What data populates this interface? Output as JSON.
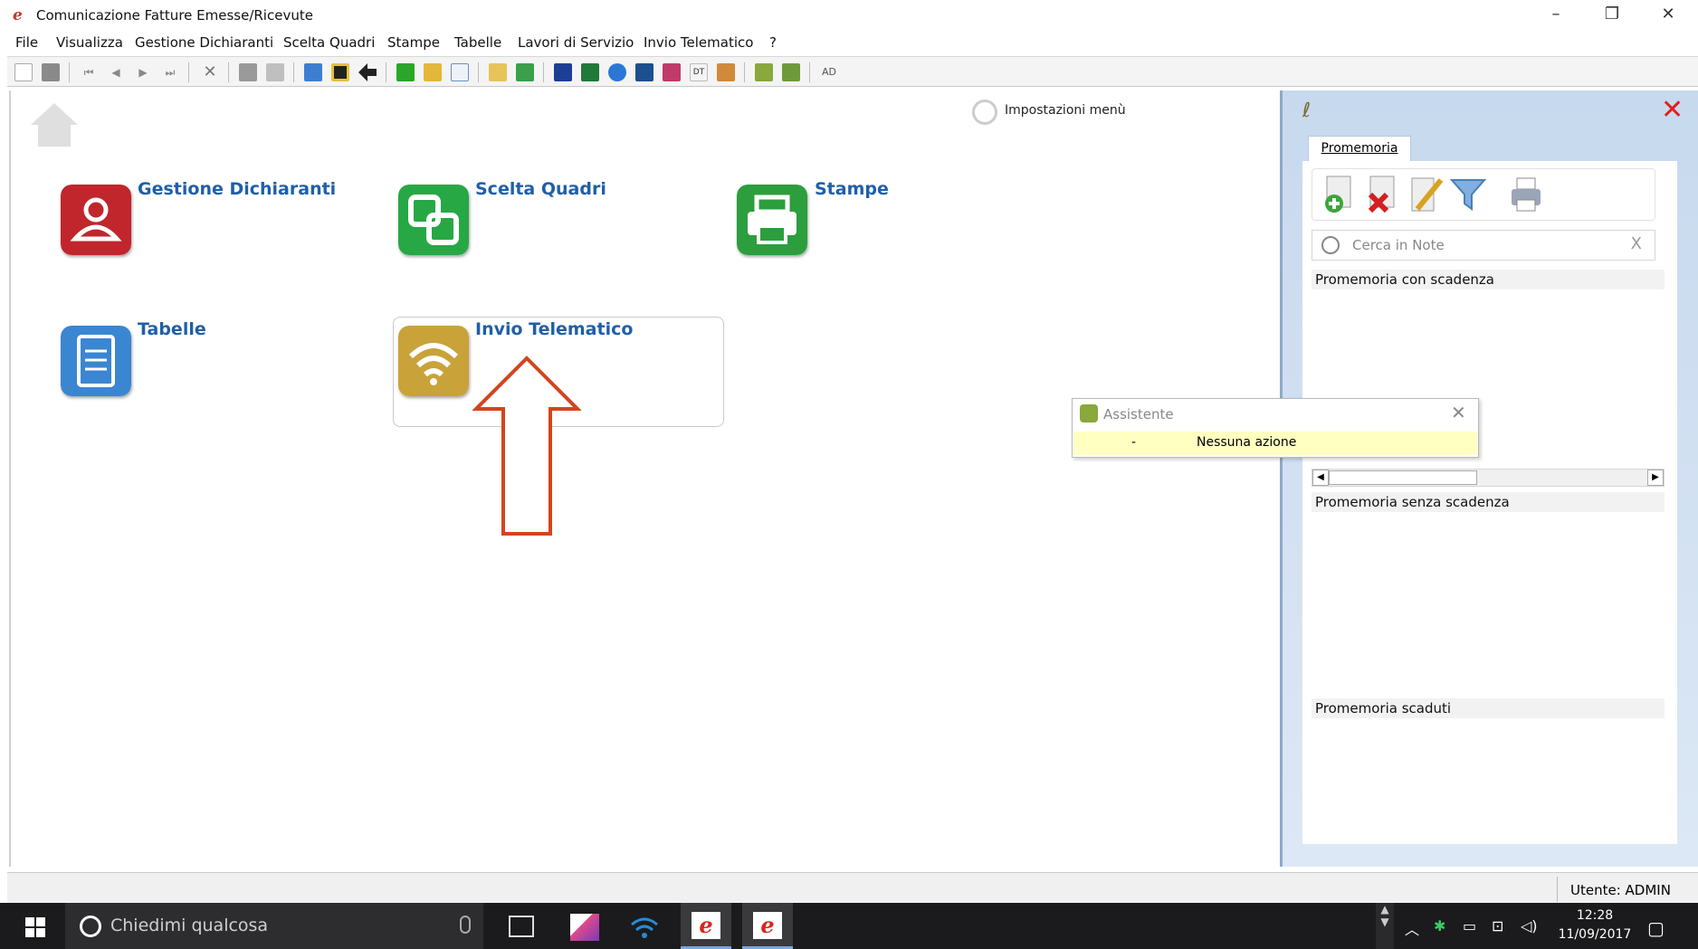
{
  "window": {
    "title": "Comunicazione Fatture Emesse/Ricevute",
    "controls": {
      "minimize": "–",
      "restore": "❐",
      "close": "✕"
    }
  },
  "menu": [
    "File",
    "Visualizza",
    "Gestione Dichiaranti",
    "Scelta Quadri",
    "Stampe",
    "Tabelle",
    "Lavori di Servizio",
    "Invio Telematico",
    "?"
  ],
  "toolbar": {
    "ad_label": "AD"
  },
  "main": {
    "settings_label": "Impostazioni menù",
    "tiles": [
      {
        "label": "Gestione Dichiaranti",
        "icon": "users-icon",
        "color": "#c0262b"
      },
      {
        "label": "Scelta Quadri",
        "icon": "quadri-icon",
        "color": "#27a844"
      },
      {
        "label": "Stampe",
        "icon": "printer-icon",
        "color": "#2c9e3d"
      },
      {
        "label": "Tabelle",
        "icon": "document-icon",
        "color": "#3b86d1"
      },
      {
        "label": "Invio Telematico",
        "icon": "wireless-icon",
        "color": "#c9a23a"
      }
    ]
  },
  "panel": {
    "tab": "Promemoria",
    "search_placeholder": "Cerca in Note",
    "search_clear": "X",
    "sections": [
      "Promemoria con scadenza",
      "Promemoria senza scadenza",
      "Promemoria scaduti"
    ]
  },
  "assistant": {
    "title": "Assistente",
    "close": "✕",
    "row_dash": "-",
    "row_message": "Nessuna azione"
  },
  "status": {
    "user": "Utente: ADMIN"
  },
  "taskbar": {
    "search_placeholder": "Chiedimi qualcosa",
    "time": "12:28",
    "date": "11/09/2017"
  },
  "colors": {
    "accent_blue": "#1f5fa8",
    "close_red": "#e0201b",
    "assistant_bg": "#ffffc2",
    "arrow": "#d2451e"
  }
}
